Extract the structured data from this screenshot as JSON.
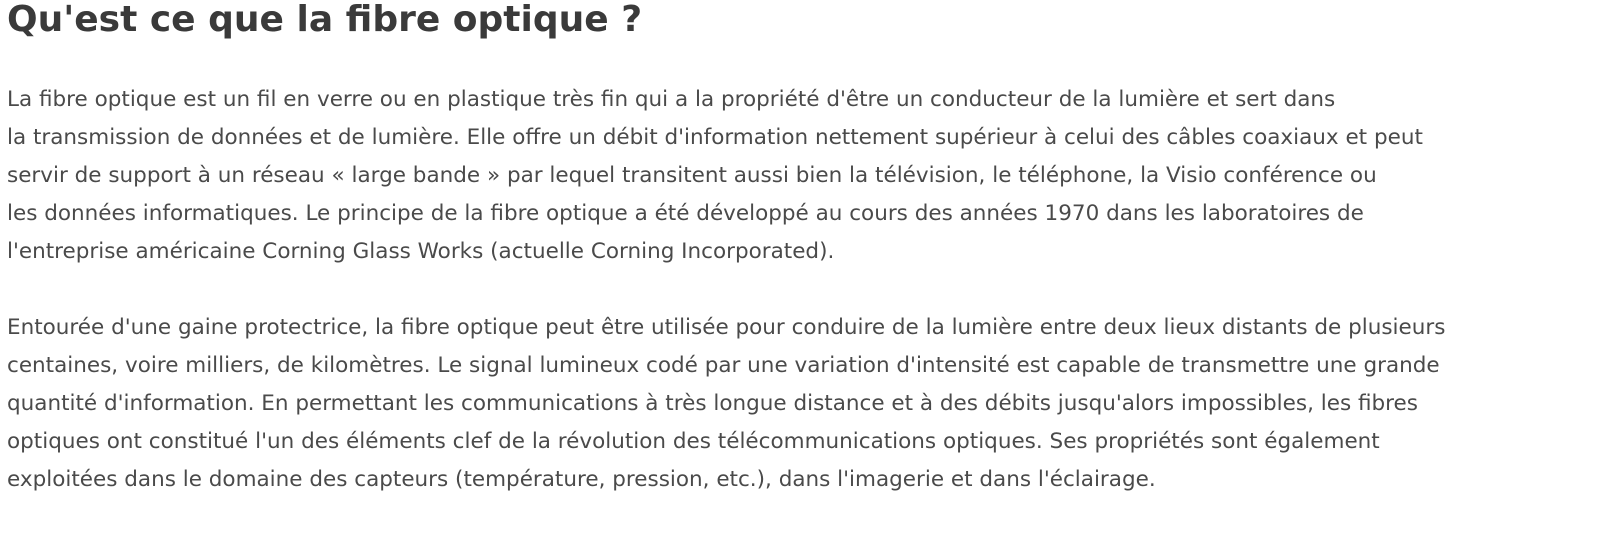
{
  "article": {
    "title": "Qu'est ce que la fibre optique ?",
    "paragraphs": [
      {
        "lines": [
          "La fibre optique est un fil en verre ou en plastique très fin qui a la propriété d'être un conducteur de la lumière et sert dans",
          "la transmission de données et de lumière. Elle offre un débit d'information nettement supérieur à celui des câbles coaxiaux et peut",
          "servir de support à un réseau « large bande » par lequel transitent aussi bien la télévision, le téléphone, la Visio conférence ou",
          "les données informatiques. Le principe de la fibre optique a été développé au cours des années 1970 dans les laboratoires de",
          "l'entreprise américaine Corning Glass Works (actuelle Corning Incorporated)."
        ]
      },
      {
        "lines": [
          "Entourée d'une gaine protectrice, la fibre optique peut être utilisée pour conduire de la lumière entre deux lieux distants de plusieurs",
          "centaines, voire milliers, de kilomètres. Le signal lumineux codé par une variation d'intensité est capable de transmettre une grande",
          "quantité d'information. En permettant les communications à très longue distance et à des débits jusqu'alors impossibles, les fibres",
          "optiques ont constitué l'un des éléments clef de la révolution des télécommunications optiques. Ses propriétés sont également",
          "exploitées dans le domaine des capteurs (température, pression, etc.), dans l'imagerie et dans l'éclairage."
        ]
      }
    ]
  }
}
